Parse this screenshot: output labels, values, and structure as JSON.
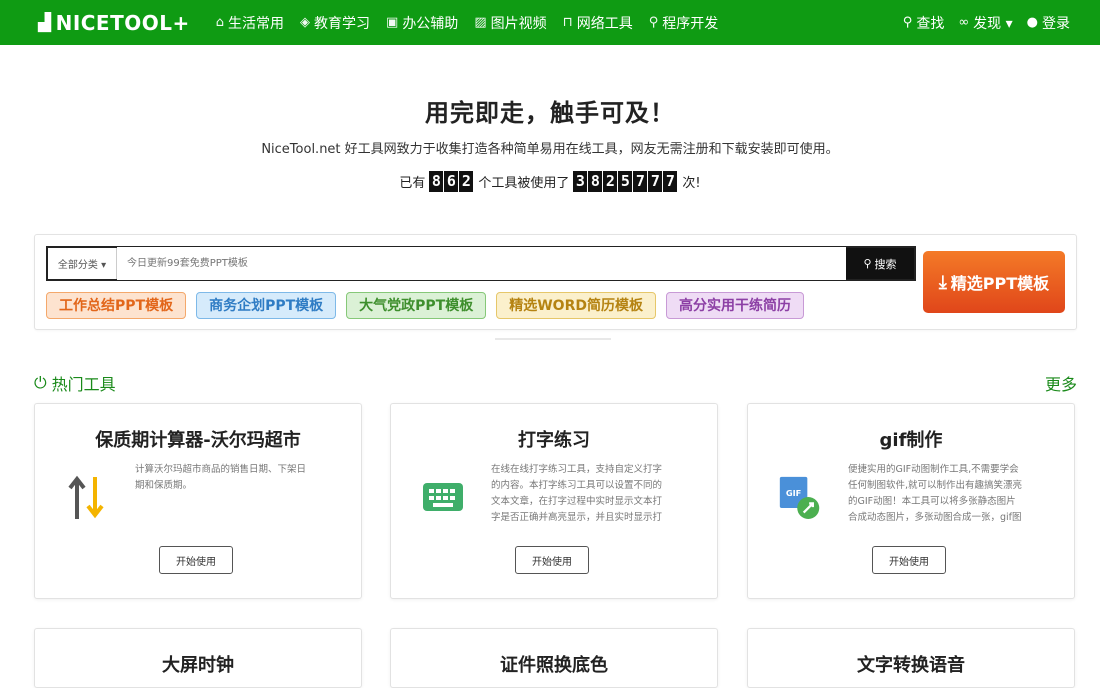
{
  "header": {
    "logo_text": "NICETOOL+",
    "nav": [
      {
        "icon": "home-icon",
        "label": "生活常用"
      },
      {
        "icon": "graduation-cap-icon",
        "label": "教育学习"
      },
      {
        "icon": "briefcase-icon",
        "label": "办公辅助"
      },
      {
        "icon": "image-icon",
        "label": "图片视频"
      },
      {
        "icon": "network-icon",
        "label": "网络工具"
      },
      {
        "icon": "wrench-icon",
        "label": "程序开发"
      }
    ],
    "right": [
      {
        "icon": "search-icon",
        "label": "查找"
      },
      {
        "icon": "binoculars-icon",
        "label": "发现 ▾"
      },
      {
        "icon": "wechat-icon",
        "label": "登录"
      }
    ]
  },
  "hero": {
    "title": "用完即走，触手可及！",
    "subtitle": "NiceTool.net 好工具网致力于收集打造各种简单易用在线工具，网友无需注册和下载安装即可使用。",
    "stats_prefix": "已有",
    "tool_count_digits": [
      "8",
      "6",
      "2"
    ],
    "stats_middle": "个工具被使用了",
    "usage_digits": [
      "3",
      "8",
      "2",
      "5",
      "7",
      "7",
      "7"
    ],
    "stats_suffix": "次!"
  },
  "search": {
    "category_label": "全部分类 ▾",
    "placeholder": "今日更新99套免费PPT模板",
    "button_label": "搜索",
    "tags": [
      {
        "label": "工作总结PPT模板",
        "bg": "#fde3cf",
        "border": "#f4a86b",
        "color": "#e2661a"
      },
      {
        "label": "商务企划PPT模板",
        "bg": "#d6ebfb",
        "border": "#7eb9e8",
        "color": "#2f7cc4"
      },
      {
        "label": "大气党政PPT模板",
        "bg": "#dbf1d6",
        "border": "#86c878",
        "color": "#3e8f2d"
      },
      {
        "label": "精选WORD简历模板",
        "bg": "#fbf0cc",
        "border": "#e6c76a",
        "color": "#b58312"
      },
      {
        "label": "高分实用干练简历",
        "bg": "#efdcf5",
        "border": "#c89ad6",
        "color": "#8c3fa5"
      }
    ],
    "cta_label": "精选PPT模板"
  },
  "section": {
    "title": "热门工具",
    "more": "更多"
  },
  "cards": [
    {
      "title": "保质期计算器-沃尔玛超市",
      "icon": "sort-arrows-icon",
      "desc": "计算沃尔玛超市商品的销售日期、下架日期和保质期。",
      "button": "开始使用"
    },
    {
      "title": "打字练习",
      "icon": "keyboard-icon",
      "desc": "在线在线打字练习工具，支持自定义打字的内容。本打字练习工具可以设置不同的文本文章，在打字过程中实时显示文本打字是否正确并高亮显示，并且实时显示打",
      "button": "开始使用"
    },
    {
      "title": "gif制作",
      "icon": "gif-maker-icon",
      "desc": "便捷实用的GIF动图制作工具,不需要学会任何制图软件,就可以制作出有趣搞笑漂亮的GIF动图！本工具可以将多张静态图片合成动态图片，多张动图合成一张，gif图",
      "button": "开始使用"
    }
  ],
  "cards_row2": [
    {
      "title": "大屏时钟"
    },
    {
      "title": "证件照换底色"
    },
    {
      "title": "文字转换语音"
    }
  ]
}
